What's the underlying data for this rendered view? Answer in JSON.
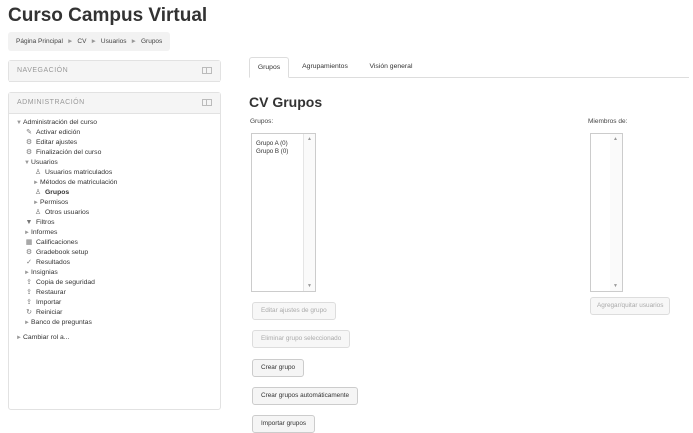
{
  "site": {
    "title": "Curso Campus Virtual"
  },
  "breadcrumb": [
    "Página Principal",
    "CV",
    "Usuarios",
    "Grupos"
  ],
  "navigation": {
    "title": "NAVEGACIÓN"
  },
  "admin": {
    "title": "ADMINISTRACIÓN",
    "items": [
      "Administración del curso",
      "Activar edición",
      "Editar ajustes",
      "Finalización del curso",
      "Usuarios",
      "Usuarios matriculados",
      "Métodos de matriculación",
      "Grupos",
      "Permisos",
      "Otros usuarios",
      "Filtros",
      "Informes",
      "Calificaciones",
      "Gradebook setup",
      "Resultados",
      "Insignias",
      "Copia de seguridad",
      "Restaurar",
      "Importar",
      "Reiniciar",
      "Banco de preguntas"
    ],
    "switch_role": "Cambiar rol a..."
  },
  "tabs": [
    "Grupos",
    "Agrupamientos",
    "Visión general"
  ],
  "main": {
    "heading": "CV Grupos",
    "groups_label": "Grupos:",
    "groups": [
      "Grupo A (0)",
      "Grupo B (0)"
    ],
    "members_label": "Miembros de:",
    "buttons": {
      "edit_group": "Editar ajustes de grupo",
      "delete_group": "Eliminar grupo seleccionado",
      "create_group": "Crear grupo",
      "auto_create": "Crear grupos automáticamente",
      "import_groups": "Importar grupos",
      "add_remove_users": "Agregar/quitar usuarios"
    }
  }
}
